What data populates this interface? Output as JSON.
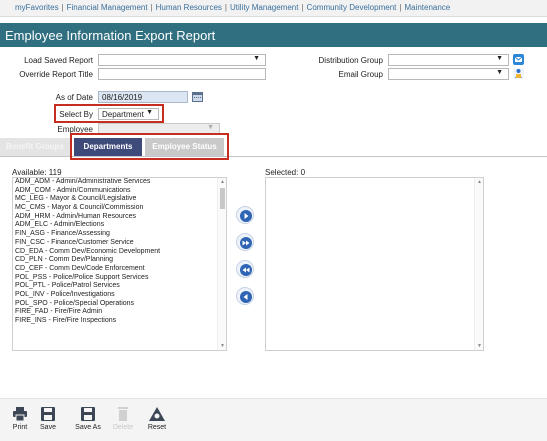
{
  "topnav": {
    "items": [
      "myFavorites",
      "Financial Management",
      "Human Resources",
      "Utility Management",
      "Community Development",
      "Maintenance"
    ]
  },
  "page_title": "Employee Information Export Report",
  "form": {
    "load_saved_report_label": "Load Saved Report",
    "override_title_label": "Override Report Title",
    "distribution_group_label": "Distribution Group",
    "email_group_label": "Email Group",
    "as_of_date_label": "As of Date",
    "as_of_date_value": "08/16/2019",
    "select_by_label": "Select By",
    "select_by_value": "Department",
    "employee_label": "Employee"
  },
  "tabs": [
    {
      "label": "Benefit Groups",
      "state": "faded"
    },
    {
      "label": "Departments",
      "state": "active"
    },
    {
      "label": "Employee Status",
      "state": "inactive"
    }
  ],
  "available": {
    "label": "Available: 119",
    "items": [
      "ADM_ADM - Admin/Administrative Services",
      "ADM_COM - Admin/Communications",
      "MC_LEG - Mayor & Council/Legislative",
      "MC_CMS - Mayor & Council/Commission",
      "ADM_HRM - Admin/Human Resources",
      "ADM_ELC - Admin/Elections",
      "FIN_ASG - Finance/Assessing",
      "FIN_CSC - Finance/Customer Service",
      "CD_EDA - Comm Dev/Economic Development",
      "CD_PLN - Comm Dev/Planning",
      "CD_CEF - Comm Dev/Code Enforcement",
      "POL_PSS - Police/Police Support Services",
      "POL_PTL - Police/Patrol Services",
      "POL_INV - Police/Investigations",
      "POL_SPO - Police/Special Operations",
      "FIRE_FAD - Fire/Fire Admin",
      "FIRE_INS - Fire/Fire Inspections"
    ]
  },
  "selected": {
    "label": "Selected: 0"
  },
  "toolbar": {
    "print": "Print",
    "save": "Save",
    "save_as": "Save As",
    "delete": "Delete",
    "reset": "Reset"
  },
  "colors": {
    "title_bar": "#2f6f80",
    "nav_link": "#3a6f9c",
    "active_tab": "#3d4a7a",
    "highlight_box": "#c62d1f",
    "distribution_icon": "#2e87d6",
    "email_icon": "#2c6fd0"
  }
}
